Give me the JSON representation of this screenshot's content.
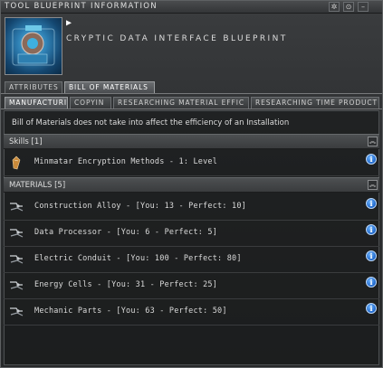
{
  "window": {
    "title": "TOOL BLUEPRINT INFORMATION",
    "buttons": [
      "✲",
      "⊙",
      "–"
    ]
  },
  "header": {
    "blueprint_name": "CRYPTIC DATA INTERFACE BLUEPRINT"
  },
  "tabs_top": [
    "ATTRIBUTES",
    "BILL OF MATERIALS"
  ],
  "tabs_sub": [
    "MANUFACTURI",
    "COPYIN",
    "RESEARCHING MATERIAL EFFIC",
    "RESEARCHING TIME PRODUCT"
  ],
  "note": "Bill of Materials does not take into affect the efficiency of an Installation",
  "skills": {
    "header": "Skills [1]",
    "items": [
      {
        "text": "Minmatar Encryption Methods - 1: Level",
        "icon": "skill-book-icon"
      }
    ]
  },
  "materials": {
    "header": "MATERIALS [5]",
    "items": [
      {
        "text": "Construction Alloy - [You: 13 - Perfect: 10]",
        "icon": "component-icon"
      },
      {
        "text": "Data Processor - [You: 6 - Perfect: 5]",
        "icon": "component-icon"
      },
      {
        "text": "Electric Conduit - [You: 100 - Perfect: 80]",
        "icon": "component-icon"
      },
      {
        "text": "Energy Cells - [You: 31 - Perfect: 25]",
        "icon": "component-icon"
      },
      {
        "text": "Mechanic Parts - [You: 63 - Perfect: 50]",
        "icon": "component-icon"
      }
    ]
  },
  "icons": {
    "info": "i",
    "collapse": "⌃"
  },
  "colors": {
    "accent_info": "#1b63c8",
    "panel_bg": "#2d2f31"
  }
}
